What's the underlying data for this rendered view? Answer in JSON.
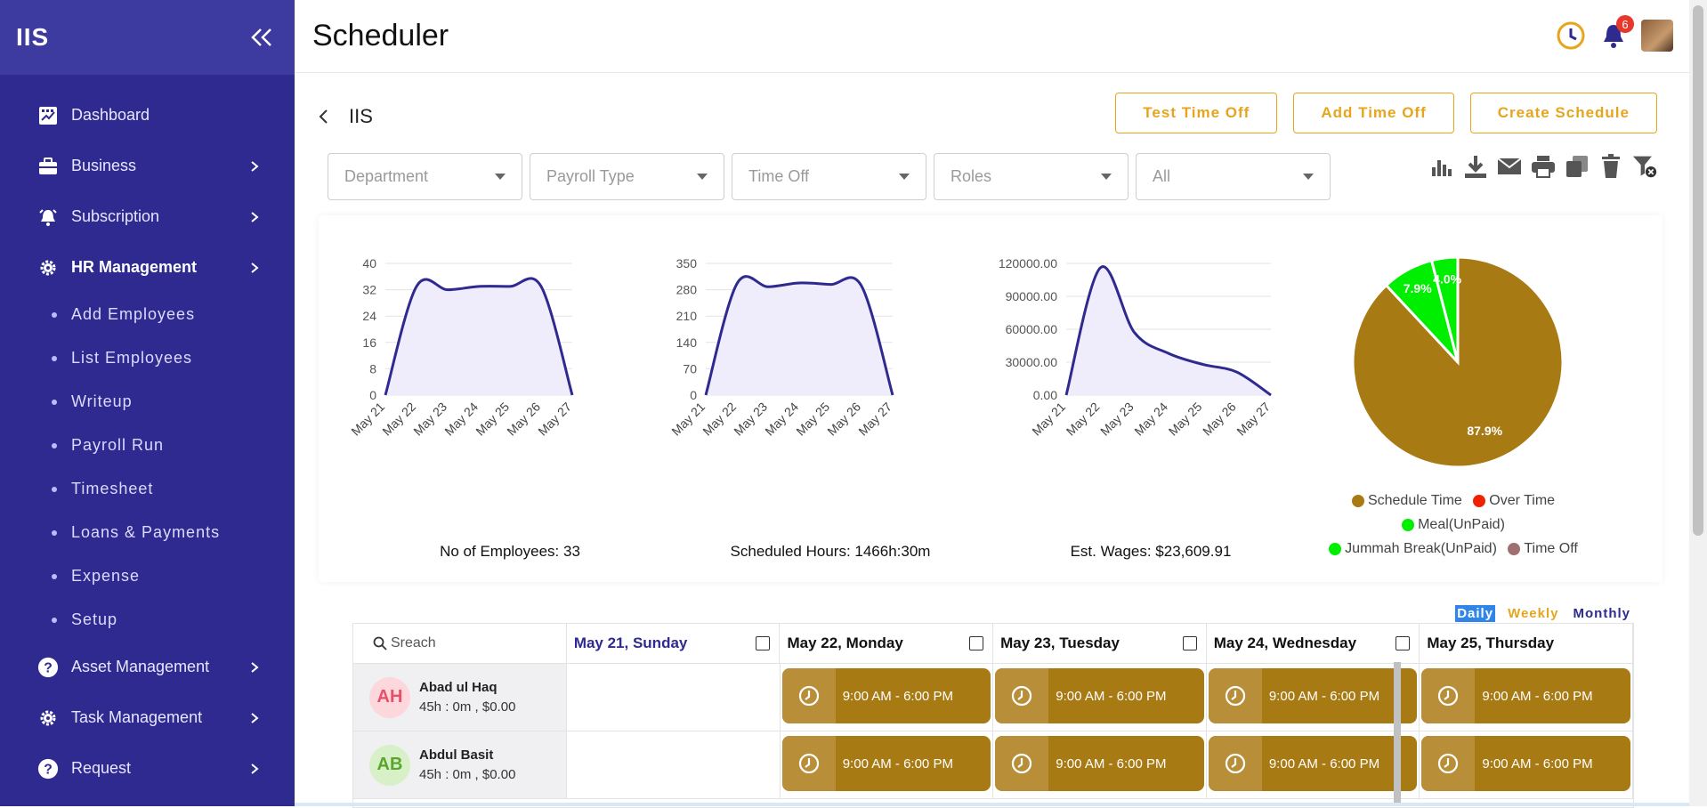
{
  "sidebar": {
    "logo": "IIS",
    "items": [
      {
        "label": "Dashboard"
      },
      {
        "label": "Business"
      },
      {
        "label": "Subscription"
      },
      {
        "label": "HR Management"
      }
    ],
    "hr_sub": [
      "Add Employees",
      "List Employees",
      "Writeup",
      "Payroll Run",
      "Timesheet",
      "Loans & Payments",
      "Expense",
      "Setup"
    ],
    "bottom_items": [
      {
        "label": "Asset Management"
      },
      {
        "label": "Task Management"
      },
      {
        "label": "Request"
      }
    ]
  },
  "header": {
    "title": "Scheduler",
    "notifications": "6"
  },
  "breadcrumb": {
    "label": "IIS"
  },
  "actions": {
    "test_time_off": "Test Time Off",
    "add_time_off": "Add Time Off",
    "create_schedule": "Create Schedule"
  },
  "filters": {
    "department": "Department",
    "payroll_type": "Payroll Type",
    "time_off": "Time Off",
    "roles": "Roles",
    "all": "All"
  },
  "colors": {
    "sidebar": "#2e2a8f",
    "accent": "#e6a51d",
    "line": "#2e2a8f",
    "shift": "#a87a14",
    "green": "#00ee00"
  },
  "chart_data": [
    {
      "type": "area",
      "x": [
        "May 21",
        "May 22",
        "May 23",
        "May 24",
        "May 25",
        "May 26",
        "May 27"
      ],
      "values": [
        0,
        33,
        32,
        33,
        33,
        33,
        0
      ],
      "yticks": [
        "0",
        "8",
        "16",
        "24",
        "32",
        "40"
      ],
      "ylim": [
        0,
        40
      ],
      "caption": "No of Employees: 33"
    },
    {
      "type": "area",
      "x": [
        "May 21",
        "May 22",
        "May 23",
        "May 24",
        "May 25",
        "May 26",
        "May 27"
      ],
      "values": [
        0,
        296,
        288,
        298,
        294,
        290,
        0
      ],
      "yticks": [
        "0",
        "70",
        "140",
        "210",
        "280",
        "350"
      ],
      "ylim": [
        0,
        350
      ],
      "caption": "Scheduled Hours: 1466h:30m"
    },
    {
      "type": "area",
      "x": [
        "May 21",
        "May 22",
        "May 23",
        "May 24",
        "May 25",
        "May 26",
        "May 27"
      ],
      "values": [
        0,
        116000,
        57000,
        38000,
        28000,
        21000,
        0
      ],
      "yticks": [
        "0.00",
        "30000.00",
        "60000.00",
        "90000.00",
        "120000.00"
      ],
      "ylim": [
        0,
        120000
      ],
      "caption": "Est. Wages: $23,609.91"
    },
    {
      "type": "pie",
      "slices": [
        {
          "name": "Schedule Time",
          "value": 87.9,
          "label": "87.9%",
          "color": "#a87a14"
        },
        {
          "name": "Over Time",
          "value": 0,
          "color": "#ee2200"
        },
        {
          "name": "Meal(UnPaid)",
          "value": 7.9,
          "label": "7.9%",
          "color": "#00ee00"
        },
        {
          "name": "Jummah Break(UnPaid)",
          "value": 4.0,
          "label": "4.0%",
          "color": "#00ee00"
        },
        {
          "name": "Time Off",
          "value": 0,
          "color": "#a07070"
        }
      ]
    }
  ],
  "view_toggle": {
    "daily": "Daily",
    "weekly": "Weekly",
    "monthly": "Monthly"
  },
  "schedule": {
    "search_placeholder": "Sreach",
    "days": [
      "May 21, Sunday",
      "May 22, Monday",
      "May 23, Tuesday",
      "May 24, Wednesday",
      "May 25, Thursday"
    ],
    "employees": [
      {
        "initials": "AH",
        "name": "Abad ul Haq",
        "meta": "45h : 0m , $0.00",
        "shifts": [
          "",
          "9:00 AM - 6:00 PM",
          "9:00 AM - 6:00 PM",
          "9:00 AM - 6:00 PM",
          "9:00 AM - 6:00 PM"
        ]
      },
      {
        "initials": "AB",
        "name": "Abdul Basit",
        "meta": "45h : 0m , $0.00",
        "shifts": [
          "",
          "9:00 AM - 6:00 PM",
          "9:00 AM - 6:00 PM",
          "9:00 AM - 6:00 PM",
          "9:00 AM - 6:00 PM"
        ]
      }
    ]
  }
}
